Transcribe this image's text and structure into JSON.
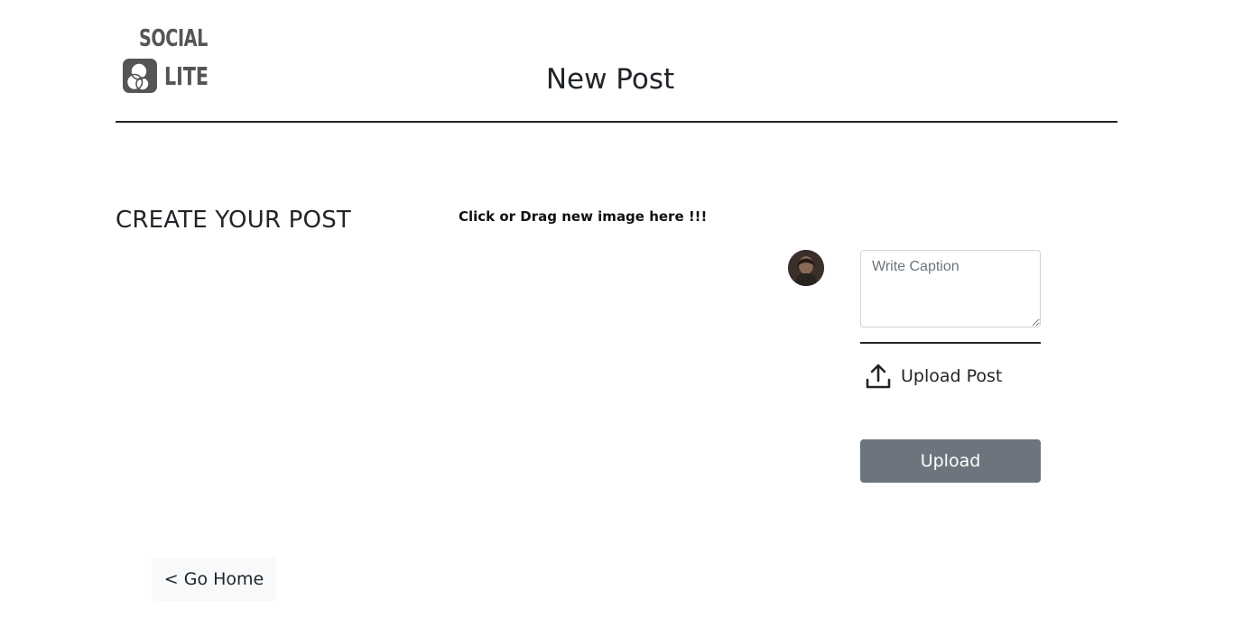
{
  "header": {
    "logo_top": "SOCIAL",
    "logo_bottom": "LITE",
    "title": "New Post"
  },
  "create": {
    "section_title": "CREATE YOUR POST",
    "drop_hint": "Click or Drag new image here !!!"
  },
  "composer": {
    "caption_placeholder": "Write Caption",
    "caption_value": "",
    "upload_post_label": "Upload Post",
    "upload_post_icon": "upload-icon",
    "upload_button_label": "Upload"
  },
  "footer": {
    "go_home_label": "< Go Home"
  },
  "colors": {
    "upload_button_bg": "#6c757d",
    "go_home_bg": "#f8f9fa",
    "text": "#212529"
  }
}
